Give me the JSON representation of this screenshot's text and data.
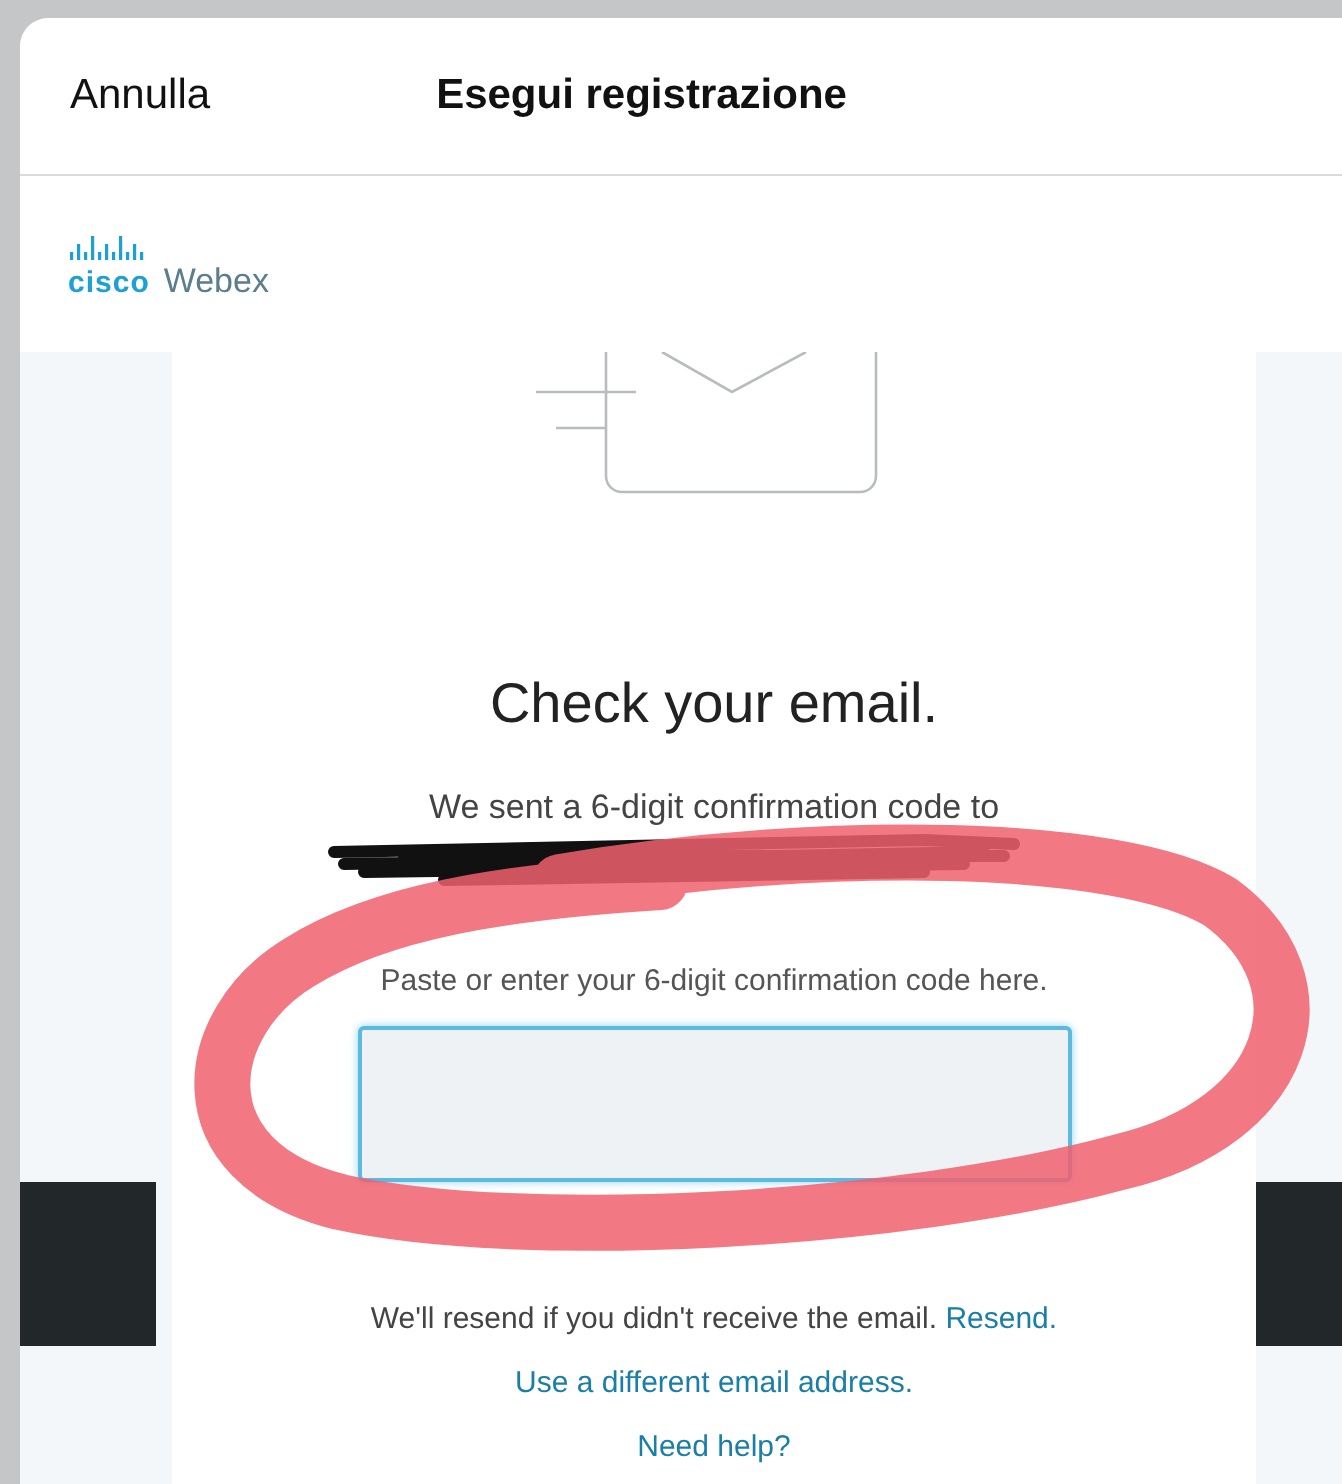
{
  "header": {
    "cancel": "Annulla",
    "title": "Esegui registrazione"
  },
  "logo": {
    "brand": "cisco",
    "product": "Webex"
  },
  "content": {
    "heading": "Check your email.",
    "sent_text": "We sent a 6-digit confirmation code to",
    "code_label": "Paste or enter your 6-digit confirmation code here.",
    "code_field": {
      "focused": true
    },
    "resend_text": "We'll resend if you didn't receive the email.",
    "resend_link": "Resend.",
    "different_email_link": "Use a different email address.",
    "help_link": "Need help?"
  }
}
